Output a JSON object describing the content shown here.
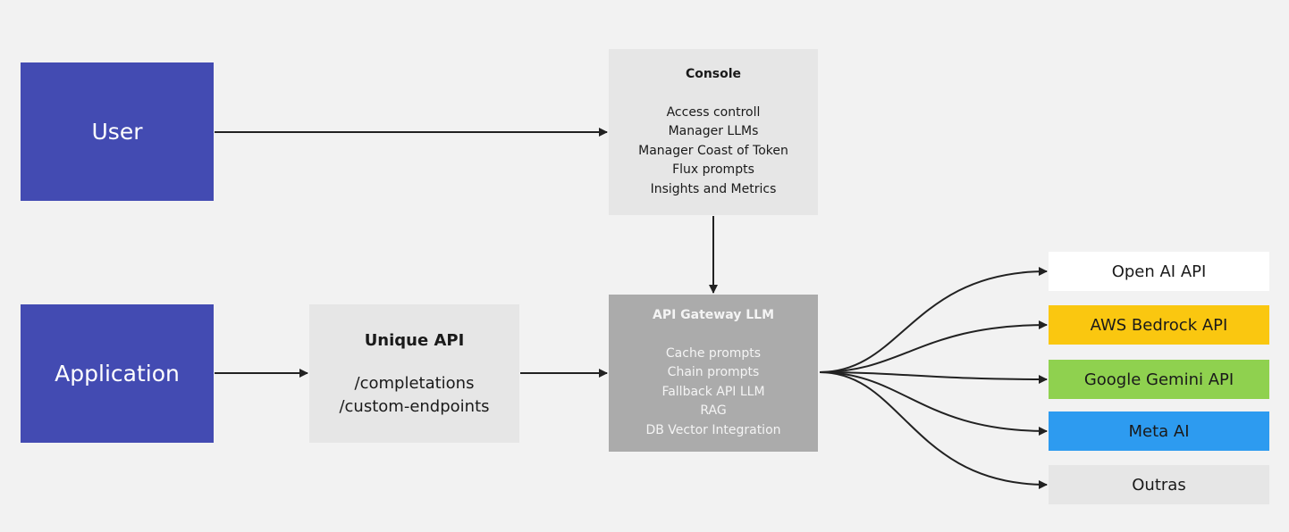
{
  "nodes": {
    "user": {
      "label": "User"
    },
    "application": {
      "label": "Application"
    },
    "unique_api": {
      "title": "Unique API",
      "items": [
        "/completations",
        "/custom-endpoints"
      ]
    },
    "console": {
      "title": "Console",
      "items": [
        "Access controll",
        "Manager LLMs",
        "Manager Coast of Token",
        "Flux prompts",
        "Insights and Metrics"
      ]
    },
    "gateway": {
      "title": "API Gateway LLM",
      "items": [
        "Cache prompts",
        "Chain prompts",
        "Fallback API LLM",
        "RAG",
        "DB Vector Integration"
      ]
    },
    "providers": [
      {
        "label": "Open AI API",
        "color": "#ffffff"
      },
      {
        "label": "AWS Bedrock API",
        "color": "#fac710"
      },
      {
        "label": "Google Gemini API",
        "color": "#8fd14f"
      },
      {
        "label": "Meta AI",
        "color": "#2d9bf0"
      },
      {
        "label": "Outras",
        "color": "#e6e6e6"
      }
    ]
  },
  "colors": {
    "actor": "#434bb2",
    "light_box": "#e6e6e6",
    "gateway": "#ababab",
    "background": "#f2f2f2"
  }
}
